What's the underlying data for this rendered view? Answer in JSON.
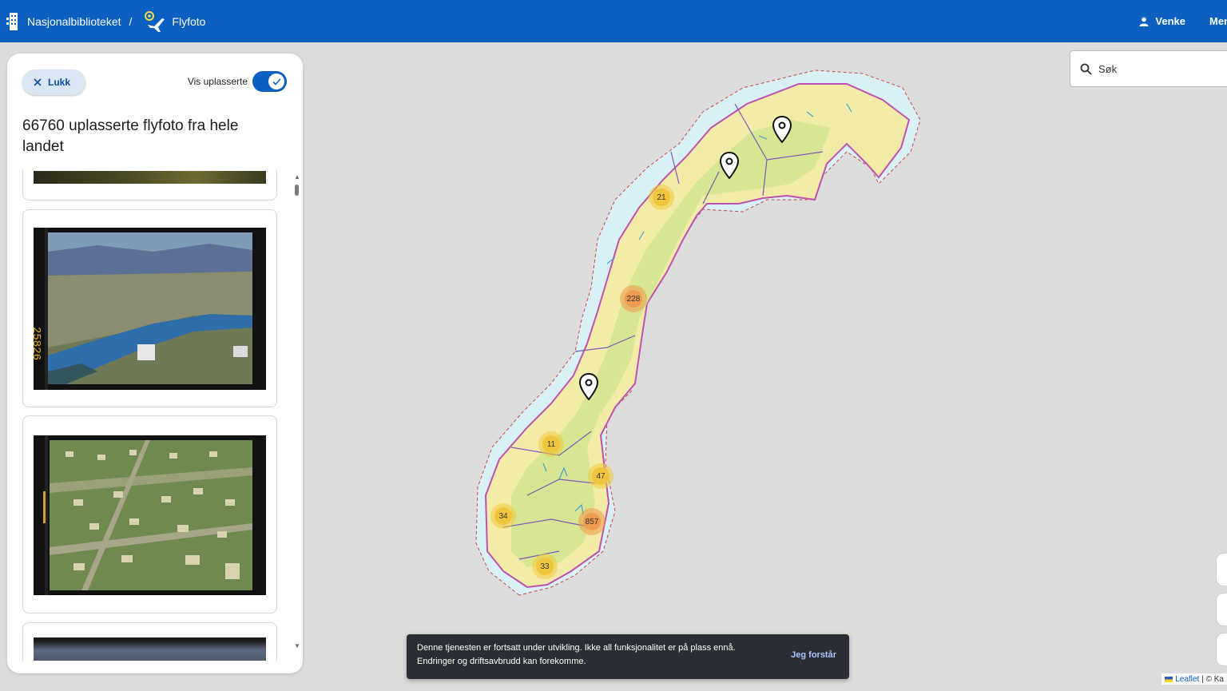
{
  "header": {
    "org_name": "Nasjonalbiblioteket",
    "separator": "/",
    "app_name": "Flyfoto",
    "user_name": "Venke",
    "menu_label": "Meny",
    "background_color": "#0a5fbf"
  },
  "panel": {
    "close_label": "Lukk",
    "toggle_label": "Vis uplasserte",
    "toggle_on": true,
    "title": "66760 uplasserte flyfoto fra hele landet",
    "photos": [
      {
        "name": "partial-top"
      },
      {
        "name": "fjord-village"
      },
      {
        "name": "residential-area"
      },
      {
        "name": "partial-bottom"
      }
    ]
  },
  "search": {
    "placeholder": "Søk"
  },
  "map": {
    "clusters": [
      {
        "count": "21",
        "color": "yellow"
      },
      {
        "count": "228",
        "color": "orange"
      },
      {
        "count": "11",
        "color": "yellow"
      },
      {
        "count": "47",
        "color": "yellow"
      },
      {
        "count": "857",
        "color": "orange"
      },
      {
        "count": "34",
        "color": "yellow"
      },
      {
        "count": "33",
        "color": "yellow"
      }
    ],
    "pins": 3
  },
  "snackbar": {
    "message": "Denne tjenesten er fortsatt under utvikling. Ikke all funksjonalitet er på plass ennå. Endringer og driftsavbrudd kan forekomme.",
    "action": "Jeg forstår"
  },
  "attribution": {
    "leaflet": "Leaflet",
    "rest": "| © Ka"
  }
}
